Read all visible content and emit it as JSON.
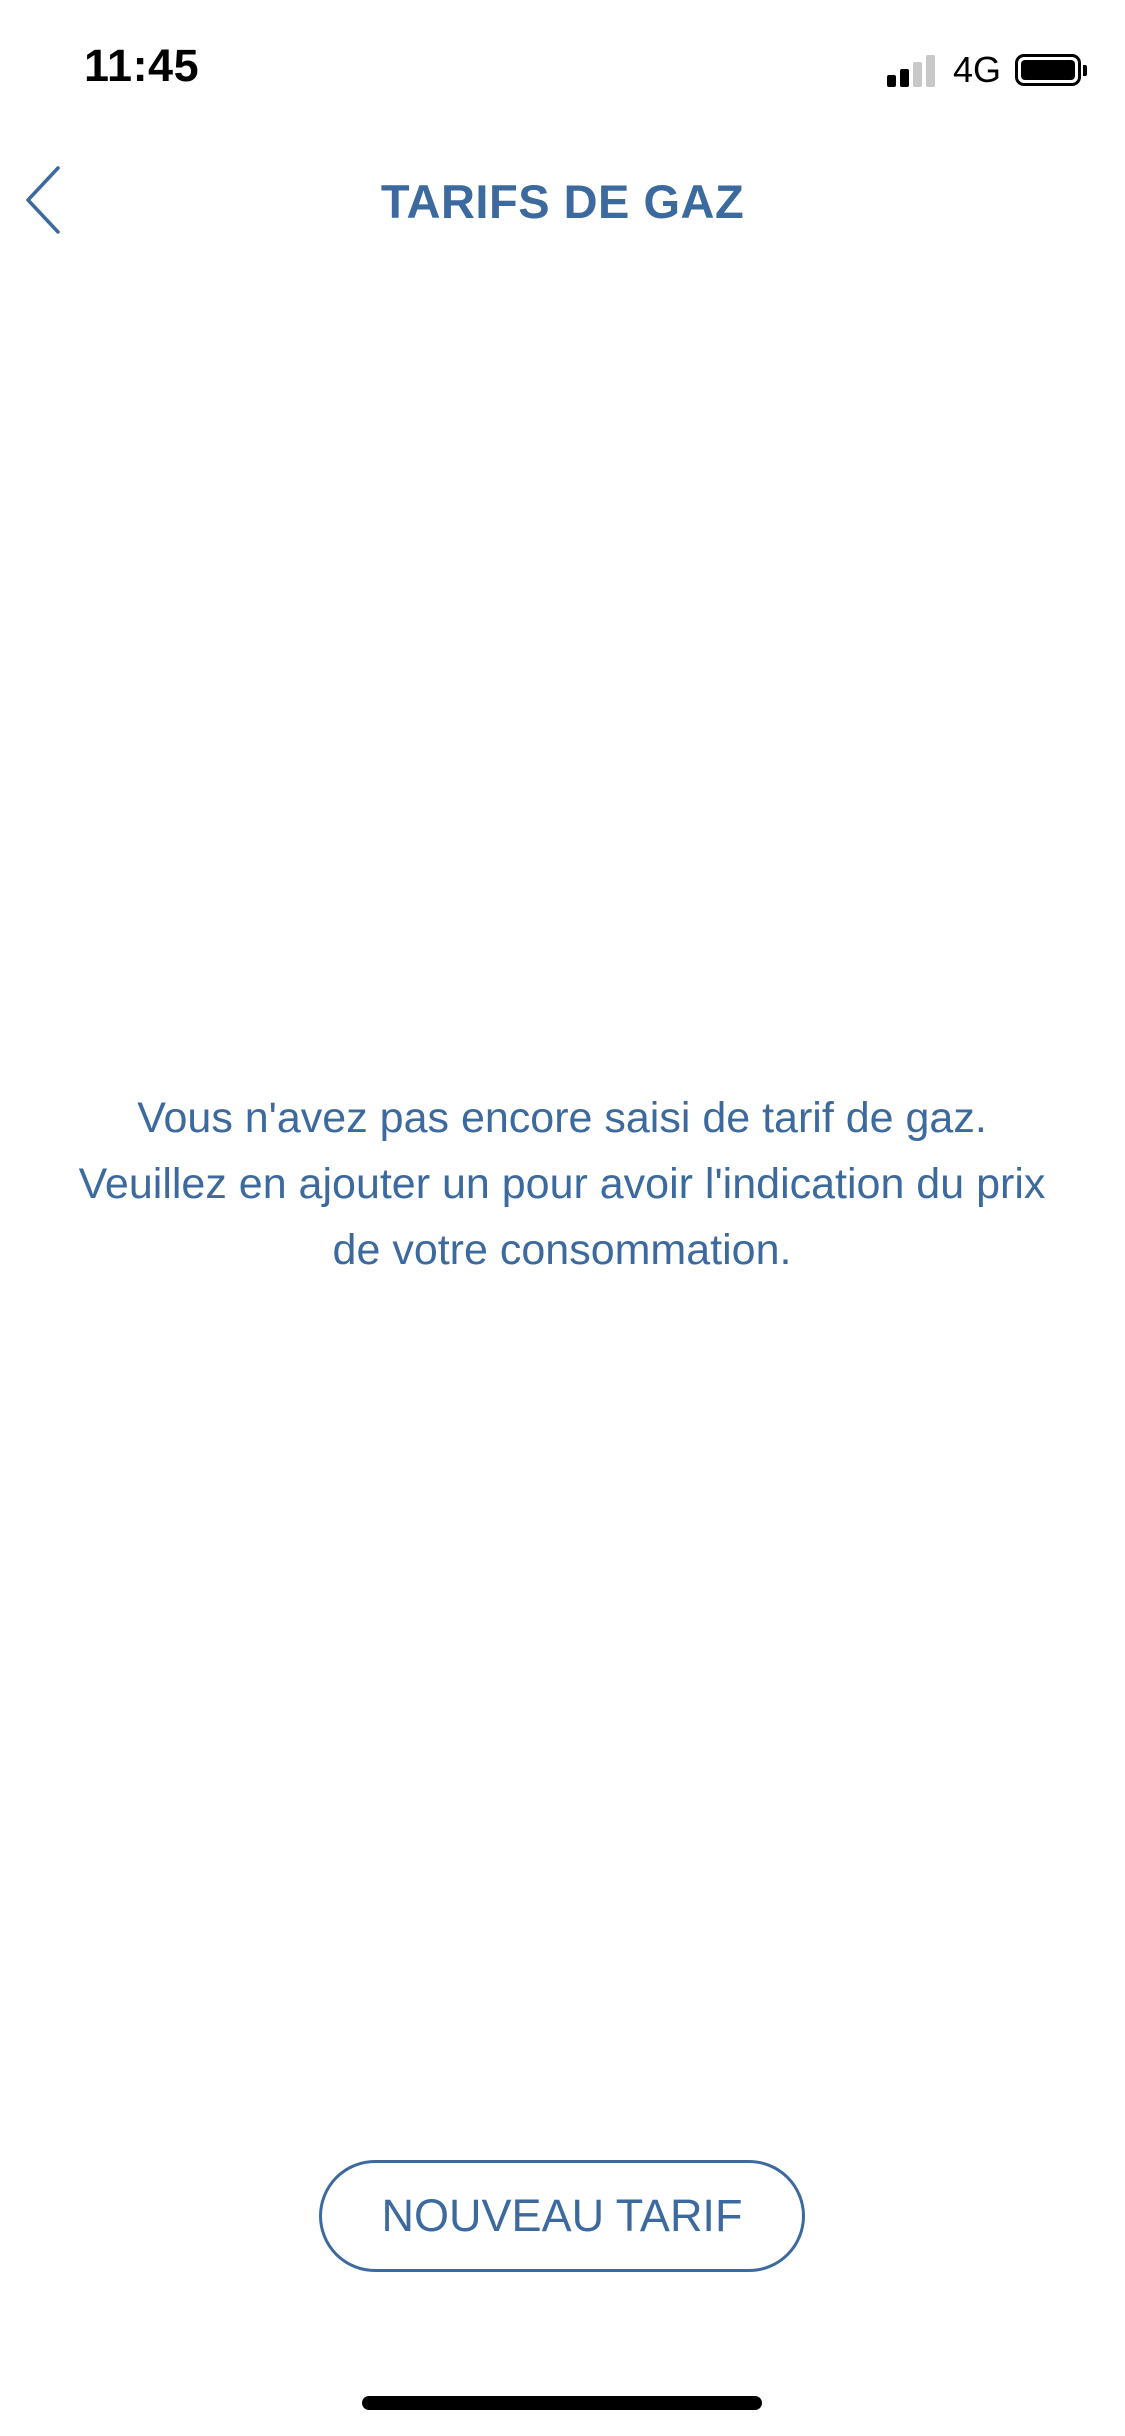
{
  "status_bar": {
    "time": "11:45",
    "network": "4G",
    "signal_bars_active": 2,
    "signal_bars_total": 4,
    "battery_level": 1.0,
    "icons": [
      "signal-icon",
      "battery-icon"
    ]
  },
  "nav": {
    "back_icon": "chevron-left-icon",
    "title": "TARIFS DE GAZ"
  },
  "empty_state": {
    "message": "Vous n'avez pas encore saisi de tarif de gaz. Veuillez en ajouter un pour avoir l'indication du prix de votre consommation."
  },
  "actions": {
    "new_tariff_label": "NOUVEAU TARIF"
  },
  "colors": {
    "accent": "#3d6a9e",
    "background": "#ffffff",
    "status_text": "#000000",
    "signal_inactive": "#c8c8c8"
  }
}
